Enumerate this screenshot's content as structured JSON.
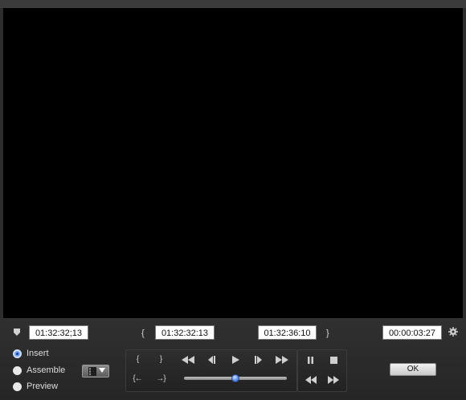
{
  "timecodes": {
    "duration": "01:32:32;13",
    "in_point": "01:32:32:13",
    "out_point": "01:32:36:10",
    "total": "00:00:03:27"
  },
  "mode_options": [
    {
      "label": "Insert",
      "selected": true
    },
    {
      "label": "Assemble",
      "selected": false
    },
    {
      "label": "Preview",
      "selected": false
    }
  ],
  "transport": {
    "scrub_position": 0.5
  },
  "ok_label": "OK",
  "colors": {
    "accent": "#4f86e8",
    "video_bg": "#000000",
    "panel_bg": "#2d2d2d"
  }
}
